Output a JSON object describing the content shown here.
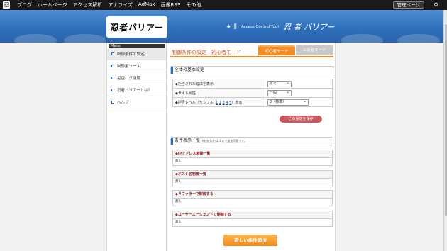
{
  "topbar": {
    "nav": [
      "ブログ",
      "ホームページ",
      "アクセス解析",
      "アナライズ",
      "AdMax",
      "画像RSS",
      "その他"
    ],
    "admin_label": "管理ページ",
    "icons": {
      "logo": "ninja-logo-icon",
      "settings": "gear-icon"
    }
  },
  "banner": {
    "brand": "忍者バリアー",
    "access_control": "Access Control Tool",
    "title_right": "忍 者 バリアー"
  },
  "sidebar": {
    "title": "Menu",
    "items": [
      {
        "label": "制御条件の設定"
      },
      {
        "label": "制御用ソース"
      },
      {
        "label": "拒否ログ閲覧"
      },
      {
        "label": "忍者バリアーとは？"
      },
      {
        "label": "ヘルプ"
      }
    ]
  },
  "main": {
    "page_title": "制御条件の設定 - 初心者モード",
    "tabs": {
      "basic": "初心者モード",
      "advanced": "上級者モード"
    },
    "basic_settings": {
      "heading": "全体の基本設定",
      "rows": [
        {
          "label": "◆拒否された理由を表示",
          "value": "する"
        },
        {
          "label": "◆サイト属性",
          "value": "一般"
        },
        {
          "label_prefix": "◆拒否レベル（サンプル: ",
          "levels": [
            "1",
            "2",
            "3",
            "4",
            "5"
          ],
          "label_suffix": "）表示",
          "value": "3（標準）"
        }
      ],
      "save_button": "この設定を保存"
    },
    "conditions": {
      "heading": "条件表示一覧",
      "note": "※制御条件は30まで追加可能です。",
      "items": [
        {
          "title": "◆IPアドレス制御一覧",
          "body": "無し"
        },
        {
          "title": "◆ホスト名制御一覧",
          "body": "無し"
        },
        {
          "title": "◆リファラーで制御する",
          "body": "無し"
        },
        {
          "title": "◆ユーザーエージェントで制御する",
          "body": "無し"
        }
      ]
    },
    "add_button": "新しい条件追加"
  },
  "colors": {
    "accent": "#f28c28",
    "banner": "#2e6fbb",
    "save": "#c9585f",
    "condition_title": "#8b1d1d"
  }
}
